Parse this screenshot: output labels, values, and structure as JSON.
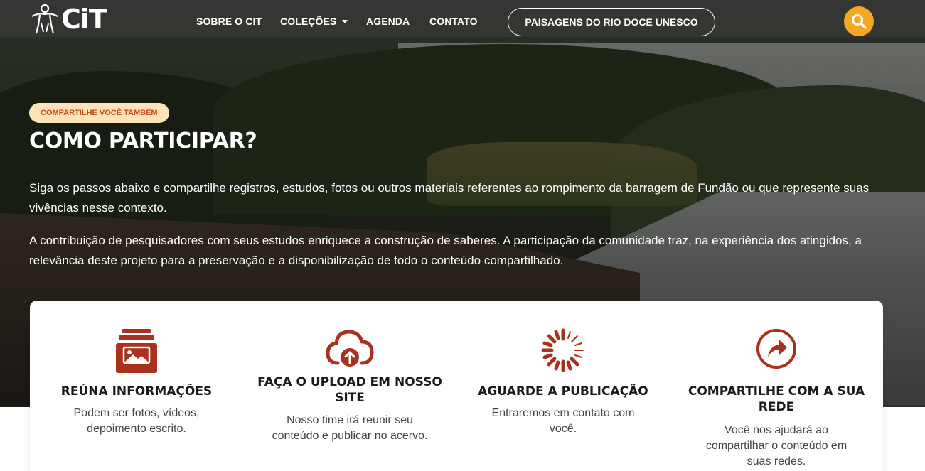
{
  "nav": {
    "logo_text": "CiT",
    "links": [
      "SOBRE O CIT",
      "COLEÇÕES",
      "AGENDA",
      "CONTATO"
    ],
    "pill_button": "PAISAGENS DO RIO DOCE UNESCO",
    "search_icon": "search-icon"
  },
  "hero": {
    "badge": "COMPARTILHE VOCÊ TAMBÉM",
    "title": "COMO PARTICIPAR?",
    "paragraph1": "Siga os passos abaixo e compartilhe registros, estudos, fotos ou outros materiais referentes ao rompimento da barragem de Fundão ou que represente suas vivências nesse contexto.",
    "paragraph2": "A contribuição de pesquisadores com seus estudos enriquece a construção de saberes. A participação da comunidade traz, na experiência dos atingidos, a relevância deste projeto para a preservação e a disponibilização de todo o conteúdo compartilhado."
  },
  "steps": [
    {
      "icon": "photo-archive-icon",
      "title": "REÚNA INFORMAÇÕES",
      "description": "Podem ser fotos, vídeos, depoimento escrito."
    },
    {
      "icon": "cloud-upload-icon",
      "title": "FAÇA O UPLOAD EM NOSSO SITE",
      "description": "Nosso time irá reunir seu conteúdo e publicar no acervo."
    },
    {
      "icon": "loading-spinner-icon",
      "title": "AGUARDE A PUBLICAÇÃO",
      "description": "Entraremos em contato com você."
    },
    {
      "icon": "share-icon",
      "title": "COMPARTILHE COM A SUA REDE",
      "description": "Você nos ajudará ao compartilhar o conteúdo em suas redes."
    }
  ],
  "colors": {
    "accent_orange": "#f5a623",
    "icon_red": "#a8321e",
    "badge_bg": "#fde3b8",
    "badge_text": "#c84a1c"
  }
}
